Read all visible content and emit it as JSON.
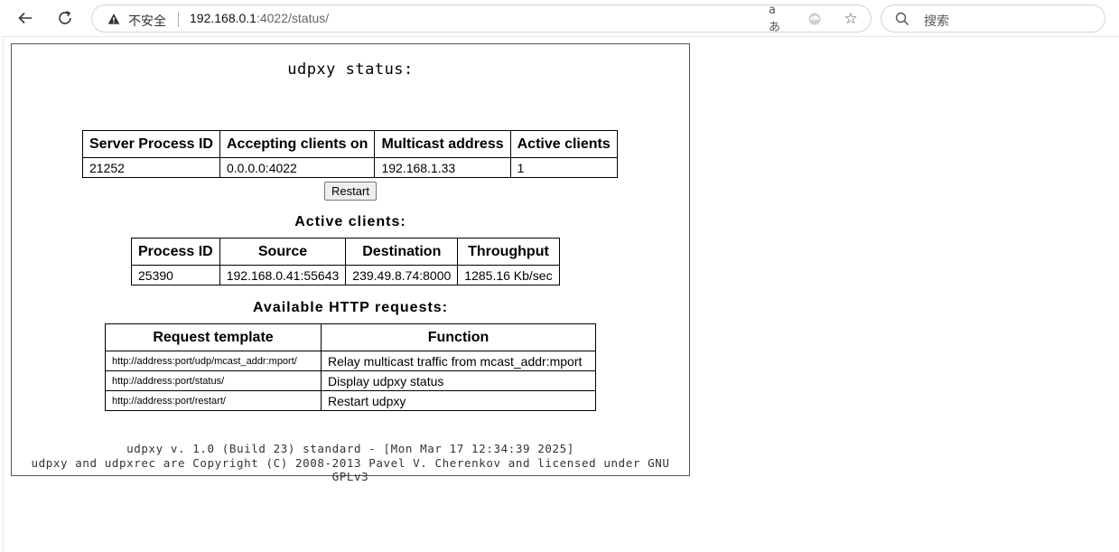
{
  "browser": {
    "security_label": "不安全",
    "url_host": "192.168.0.1",
    "url_rest": ":4022/status/",
    "read_aloud_glyph": "aあ",
    "search_placeholder": "搜索"
  },
  "page": {
    "title": "udpxy status:",
    "server_table": {
      "headers": [
        "Server Process ID",
        "Accepting clients on",
        "Multicast address",
        "Active clients"
      ],
      "row": [
        "21252",
        "0.0.0.0:4022",
        "192.168.1.33",
        "1"
      ]
    },
    "restart_label": "Restart",
    "clients_title": "Active clients:",
    "clients_table": {
      "headers": [
        "Process ID",
        "Source",
        "Destination",
        "Throughput"
      ],
      "row": [
        "25390",
        "192.168.0.41:55643",
        "239.49.8.74:8000",
        "1285.16 Kb/sec"
      ]
    },
    "requests_title": "Available HTTP requests:",
    "requests_table": {
      "headers": [
        "Request template",
        "Function"
      ],
      "rows": [
        {
          "template": "http://address:port/udp/mcast_addr:mport/",
          "function": "Relay multicast traffic from mcast_addr:mport"
        },
        {
          "template": "http://address:port/status/",
          "function": "Display udpxy status"
        },
        {
          "template": "http://address:port/restart/",
          "function": "Restart udpxy"
        }
      ]
    },
    "footer_line1": "udpxy v. 1.0 (Build 23) standard - [Mon Mar 17 12:34:39 2025]",
    "footer_line2": "udpxy and udpxrec are Copyright (C) 2008-2013 Pavel V. Cherenkov and licensed under GNU GPLv3"
  }
}
